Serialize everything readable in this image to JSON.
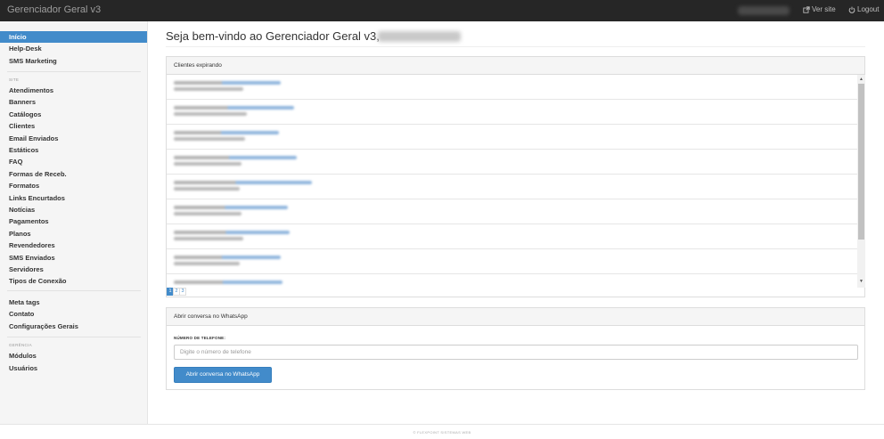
{
  "app": {
    "title": "Gerenciador Geral v3",
    "links": {
      "ver_site": "Ver site",
      "logout": "Logout"
    }
  },
  "sidebar": {
    "group1": [
      {
        "label": "Início"
      },
      {
        "label": "Help-Desk"
      },
      {
        "label": "SMS Marketing"
      }
    ],
    "section_site": "SITE",
    "group2": [
      {
        "label": "Atendimentos"
      },
      {
        "label": "Banners"
      },
      {
        "label": "Catálogos"
      },
      {
        "label": "Clientes"
      },
      {
        "label": "Email Enviados"
      },
      {
        "label": "Estáticos"
      },
      {
        "label": "FAQ"
      },
      {
        "label": "Formas de Receb."
      },
      {
        "label": "Formatos"
      },
      {
        "label": "Links Encurtados"
      },
      {
        "label": "Notícias"
      },
      {
        "label": "Pagamentos"
      },
      {
        "label": "Planos"
      },
      {
        "label": "Revendedores"
      },
      {
        "label": "SMS Enviados"
      },
      {
        "label": "Servidores"
      },
      {
        "label": "Tipos de Conexão"
      }
    ],
    "group3": [
      {
        "label": "Meta tags"
      },
      {
        "label": "Contato"
      },
      {
        "label": "Configurações Gerais"
      }
    ],
    "section_gerencia": "GERÊNCIA",
    "group4": [
      {
        "label": "Módulos"
      },
      {
        "label": "Usuários"
      }
    ]
  },
  "main": {
    "welcome": "Seja bem-vindo ao Gerenciador Geral v3,",
    "clients_panel": {
      "title": "Clientes expirando",
      "pages": [
        "1",
        "2",
        "3"
      ],
      "active_page": "1"
    },
    "whatsapp_panel": {
      "title": "Abrir conversa no WhatsApp",
      "phone_label": "NÚMERO DE TELEFONE:",
      "phone_placeholder": "Digite o número de telefone",
      "button_label": "Abrir conversa no WhatsApp"
    }
  },
  "footer": {
    "text": "© FLEXPOINT SISTEMAS WEB"
  },
  "colors": {
    "primary": "#428bca",
    "topbar": "#262626",
    "sidebar_bg": "#f5f5f5"
  },
  "icons": {
    "ver_site": "external-link-icon",
    "logout": "power-icon"
  }
}
